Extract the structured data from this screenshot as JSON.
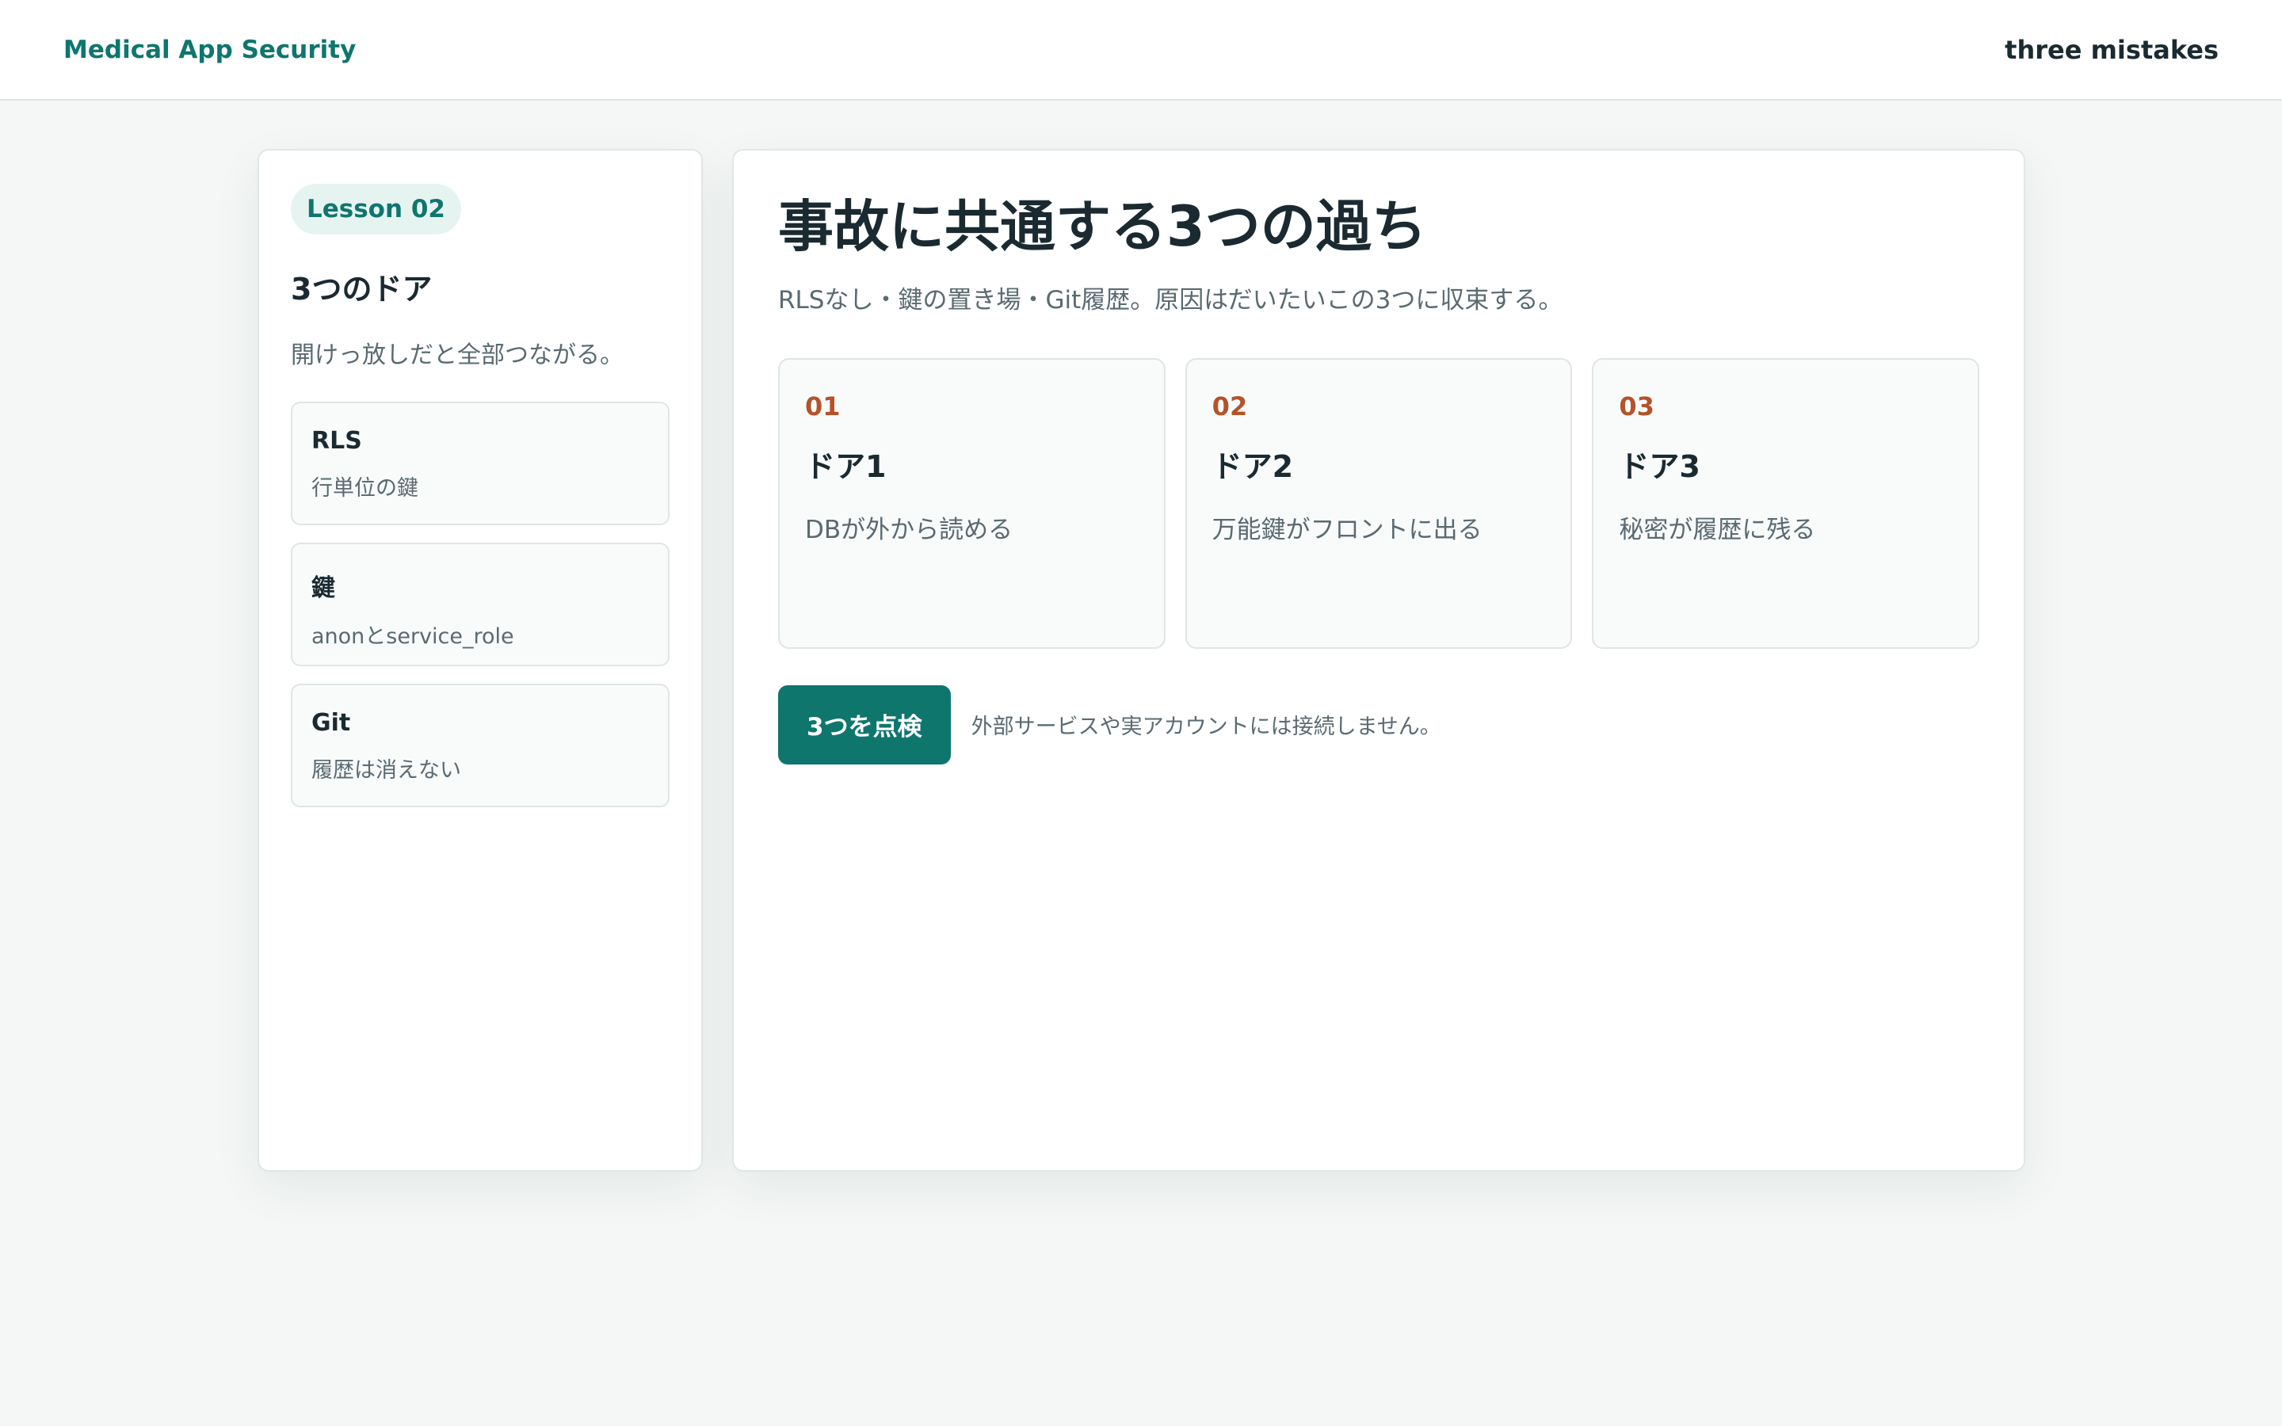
{
  "header": {
    "brand": "Medical App Security",
    "right_label": "three mistakes"
  },
  "sidebar": {
    "badge": "Lesson 02",
    "title": "3つのドア",
    "subtitle": "開けっ放しだと全部つながる。",
    "items": [
      {
        "title": "RLS",
        "desc": "行単位の鍵"
      },
      {
        "title": "鍵",
        "desc": "anonとservice_role"
      },
      {
        "title": "Git",
        "desc": "履歴は消えない"
      }
    ]
  },
  "main": {
    "title": "事故に共通する3つの過ち",
    "subtitle": "RLSなし・鍵の置き場・Git履歴。原因はだいたいこの3つに収束する。",
    "cards": [
      {
        "num": "01",
        "title": "ドア1",
        "desc": "DBが外から読める"
      },
      {
        "num": "02",
        "title": "ドア2",
        "desc": "万能鍵がフロントに出る"
      },
      {
        "num": "03",
        "title": "ドア3",
        "desc": "秘密が履歴に残る"
      }
    ],
    "button_label": "3つを点検",
    "note": "外部サービスや実アカウントには接続しません。"
  },
  "colors": {
    "accent": "#0f766e",
    "number": "#b4532a",
    "background": "#f4f7f6"
  }
}
